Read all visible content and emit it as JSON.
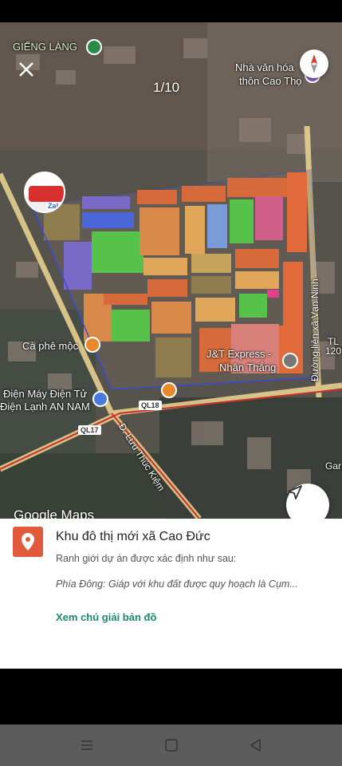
{
  "map": {
    "labels": {
      "gieng_lang": "GIẾNG LÀNG",
      "nha_van_hoa": "Nhà văn hóa",
      "thon_cao_tho": "thôn Cao Thọ",
      "duong_lien_xa": "Đường liên xã Vạn Ninh",
      "jt_express": "J&T Express -",
      "nhan_thang": "Nhân Thắng",
      "ca_phe_moc": "Cà phê mộc",
      "dien_may": "Điện Máy Điện Tử",
      "dien_lanh": "Điện Lạnh AN NAM",
      "luu_thuc_kiem": "Đ. Lưu Thúc Kiệm",
      "ql18": "QL18",
      "ql17": "QL17",
      "tl_edge": "TL",
      "tl_120": "120",
      "gar": "Gar",
      "zalo": "Zalo",
      "google_maps": "Google Maps"
    },
    "counter": "1/10",
    "close_icon": "close-icon",
    "compass_icon": "compass-icon",
    "locate_icon": "navigation-arrow-icon"
  },
  "card": {
    "title": "Khu đô thị mới xã Cao Đức",
    "line1": "Ranh giới dự án được xác định như sau:",
    "line2": "Phía Đông: Giáp với khu đất được quy hoạch là Cụm...",
    "link": "Xem chú giải bản đồ",
    "icon": "location-pin-icon",
    "accent": "#e15a3c",
    "link_color": "#1a8a6a"
  },
  "navbar": {
    "menu_icon": "menu-icon",
    "home_icon": "home-square-icon",
    "back_icon": "back-triangle-icon"
  }
}
